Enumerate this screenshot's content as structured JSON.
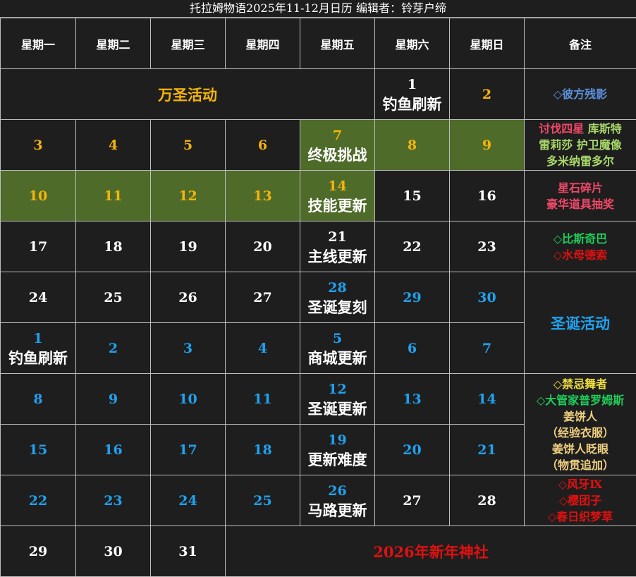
{
  "title": "托拉姆物语2025年11-12月日历 编辑者：铃芽户缔",
  "headers": [
    "星期一",
    "星期二",
    "星期三",
    "星期四",
    "星期五",
    "星期六",
    "星期日",
    "备注"
  ],
  "colors": {
    "gold": "#f5b40a",
    "white": "#ffffff",
    "blue": "#1fa2f0",
    "green_bg": "#4e6b29",
    "red": "#e01010",
    "sky": "#5b8fd8",
    "pink": "#f04868",
    "bright_green": "#1fcc5a",
    "yellow": "#f0e040",
    "khaki": "#f0d080"
  },
  "halloween_event": "万圣活动",
  "christmas_event": "圣诞活动",
  "newyear_event": "2026年新年神社",
  "days": {
    "nov1": "1",
    "nov1_evt": "钓鱼刷新",
    "nov2": "2",
    "nov3": "3",
    "nov4": "4",
    "nov5": "5",
    "nov6": "6",
    "nov7": "7",
    "nov7_evt": "终极挑战",
    "nov8": "8",
    "nov9": "9",
    "nov10": "10",
    "nov11": "11",
    "nov12": "12",
    "nov13": "13",
    "nov14": "14",
    "nov14_evt": "技能更新",
    "nov15": "15",
    "nov16": "16",
    "nov17": "17",
    "nov18": "18",
    "nov19": "19",
    "nov20": "20",
    "nov21": "21",
    "nov21_evt": "主线更新",
    "nov22": "22",
    "nov23": "23",
    "nov24": "24",
    "nov25": "25",
    "nov26": "26",
    "nov27": "27",
    "nov28": "28",
    "nov28_evt": "圣诞复刻",
    "nov29": "29",
    "nov30": "30",
    "dec1": "1",
    "dec1_evt": "钓鱼刷新",
    "dec2": "2",
    "dec3": "3",
    "dec4": "4",
    "dec5": "5",
    "dec5_evt": "商城更新",
    "dec6": "6",
    "dec7": "7",
    "dec8": "8",
    "dec9": "9",
    "dec10": "10",
    "dec11": "11",
    "dec12": "12",
    "dec12_evt": "圣诞更新",
    "dec13": "13",
    "dec14": "14",
    "dec15": "15",
    "dec16": "16",
    "dec17": "17",
    "dec18": "18",
    "dec19": "19",
    "dec19_evt": "更新难度",
    "dec20": "20",
    "dec21": "21",
    "dec22": "22",
    "dec23": "23",
    "dec24": "24",
    "dec25": "25",
    "dec26": "26",
    "dec26_evt": "马路更新",
    "dec27": "27",
    "dec28": "28",
    "dec29": "29",
    "dec30": "30",
    "dec31": "31"
  },
  "notes": {
    "r1": "◇彼方残影",
    "r2a": "讨伐四星",
    "r2b": "库斯特",
    "r2c": "雷莉莎",
    "r2d": "护卫魔像",
    "r2e": "多米纳雷多尔",
    "r3a": "星石碎片",
    "r3b": "豪华道具抽奖",
    "r4a": "◇比斯奇巴",
    "r4b": "◇水母德索",
    "r7a": "◇禁忌舞者",
    "r7b": "◇大管家普罗姆斯",
    "r7c": "姜饼人",
    "r7d": "（经验衣服）",
    "r7e": "姜饼人眨眼",
    "r7f": "（物贯追加）",
    "r9a": "◇风牙Ⅸ",
    "r9b": "◇樱团子",
    "r9c": "◇春日织梦草"
  }
}
